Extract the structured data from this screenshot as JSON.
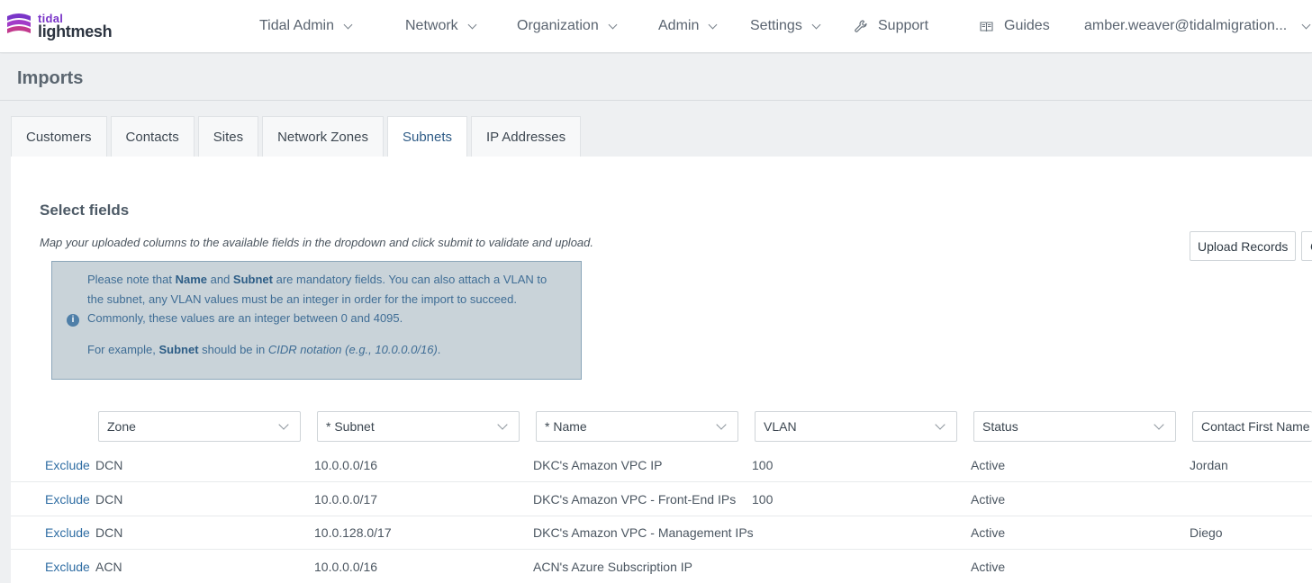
{
  "brand": {
    "small": "tidal",
    "large": "lightmesh"
  },
  "nav": {
    "items": [
      {
        "label": "Tidal Admin",
        "dropdown": true
      },
      {
        "label": "Network",
        "dropdown": true
      },
      {
        "label": "Organization",
        "dropdown": true
      },
      {
        "label": "Admin",
        "dropdown": true
      },
      {
        "label": "Settings",
        "dropdown": true
      },
      {
        "label": "Support",
        "icon": "wrench-icon"
      },
      {
        "label": "Guides",
        "icon": "book-icon"
      },
      {
        "label": "amber.weaver@tidalmigration...",
        "dropdown": true
      }
    ]
  },
  "page": {
    "title": "Imports"
  },
  "tabs": [
    {
      "label": "Customers"
    },
    {
      "label": "Contacts"
    },
    {
      "label": "Sites"
    },
    {
      "label": "Network Zones"
    },
    {
      "label": "Subnets",
      "active": true
    },
    {
      "label": "IP Addresses"
    }
  ],
  "section": {
    "title": "Select fields",
    "description": "Map your uploaded columns to the available fields in the dropdown and click submit to validate and upload."
  },
  "buttons": {
    "upload": "Upload Records",
    "cancel_partial": "C"
  },
  "alert": {
    "l1_a": "Please note that ",
    "l1_name": "Name",
    "l1_and": " and ",
    "l1_subnet": "Subnet",
    "l1_b": " are mandatory fields. You can also attach a VLAN to",
    "l2": "the subnet, any VLAN values must be an integer in order for the import to succeed.",
    "l3": "Commonly, these values are an integer between 0 and 4095.",
    "l4_a": "For example, ",
    "l4_subnet": "Subnet",
    "l4_b": " should be in ",
    "l4_c": "CIDR notation (e.g., 10.0.0.0/16)",
    "l4_d": "."
  },
  "fields": [
    "Zone",
    "* Subnet",
    "* Name",
    "VLAN",
    "Status",
    "Contact First Name"
  ],
  "exclude_label": "Exclude",
  "rows": [
    {
      "zone": "DCN",
      "subnet": "10.0.0.0/16",
      "name": "DKC's Amazon VPC IP",
      "vlan": "100",
      "status": "Active",
      "contact": "Jordan"
    },
    {
      "zone": "DCN",
      "subnet": "10.0.0.0/17",
      "name": "DKC's Amazon VPC - Front-End IPs",
      "vlan": "100",
      "status": "Active",
      "contact": ""
    },
    {
      "zone": "DCN",
      "subnet": "10.0.128.0/17",
      "name": "DKC's Amazon VPC - Management IPs",
      "vlan": "",
      "status": "Active",
      "contact": "Diego"
    },
    {
      "zone": "ACN",
      "subnet": "10.0.0.0/16",
      "name": "ACN's Azure Subscription IP",
      "vlan": "",
      "status": "Active",
      "contact": ""
    }
  ],
  "colors": {
    "link": "#2f6da3",
    "alert_bg": "#c9d3d9",
    "alert_border": "#8ba6b9",
    "brand_purple": "#7a35c8"
  }
}
